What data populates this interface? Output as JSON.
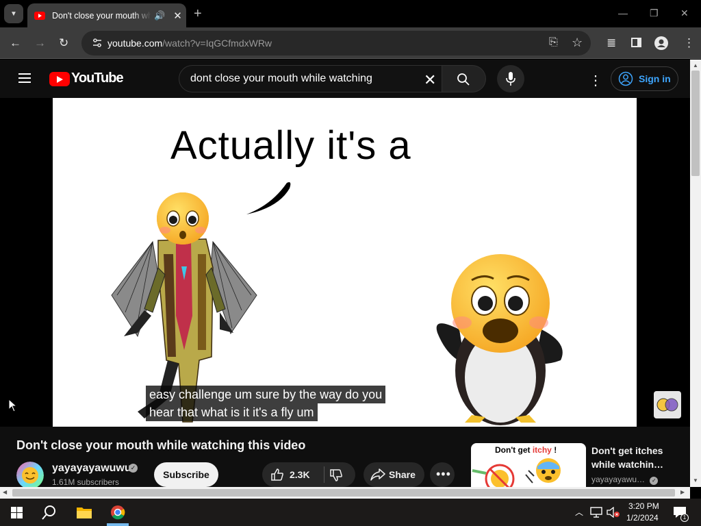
{
  "browser": {
    "tab_title": "Don't close your mouth while watching this video - YouTube",
    "url_host": "youtube.com",
    "url_path": "/watch?v=IqGCfmdxWRw"
  },
  "youtube": {
    "logo_text": "YouTube",
    "search_value": "dont close your mouth while watching",
    "signin_label": "Sign in"
  },
  "video": {
    "speech_text": "Actually it's a",
    "caption_line1": "easy challenge um sure by the way do you",
    "caption_line2": "hear that what is it it's a fly um",
    "title": "Don't close your mouth while watching this video",
    "channel_name": "yayayayawuwu",
    "subscribers": "1.61M subscribers",
    "subscribe_label": "Subscribe",
    "likes": "2.3K",
    "share_label": "Share"
  },
  "recommended": {
    "thumb_text_prefix": "Don't get ",
    "thumb_text_highlight": "itchy",
    "thumb_text_suffix": " !",
    "title": "Don't get itches while watchin…",
    "channel": "yayayayawu…"
  },
  "taskbar": {
    "time": "3:20 PM",
    "date": "1/2/2024",
    "notification_count": "1"
  }
}
